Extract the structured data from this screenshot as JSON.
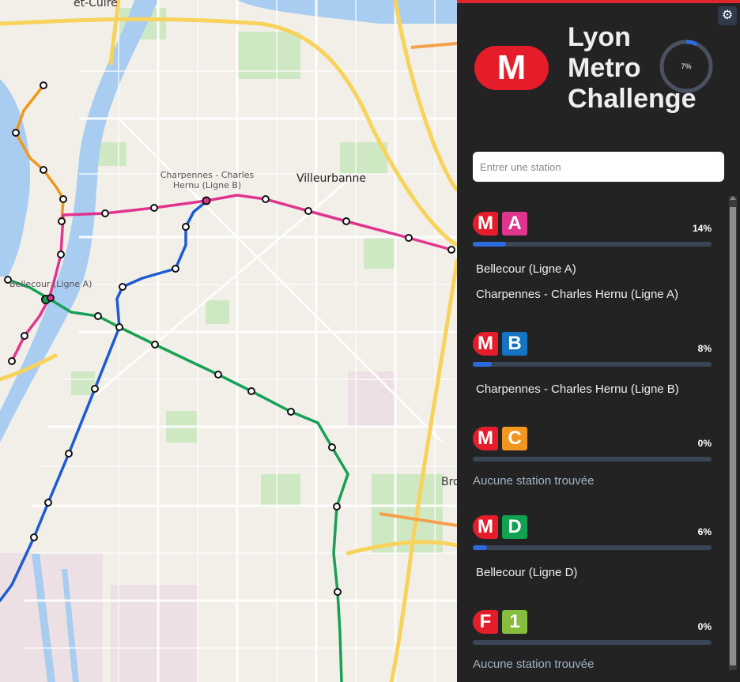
{
  "map": {
    "labels": {
      "caluire": "et-Cuire",
      "villeurbanne": "Villeurbanne",
      "charpennes_b": "Charpennes - Charles Hernu (Ligne B)",
      "bellecour_a": "Bellecour (Ligne A)",
      "bron": "Bro"
    },
    "line_colors": {
      "A": "#e0358f",
      "B": "#1d5bd1",
      "C": "#f0961d",
      "D": "#17a154",
      "F1": "#8bbf3a"
    }
  },
  "panel": {
    "settings_icon": "gear-icon",
    "logo_letter": "M",
    "title_lines": [
      "Lyon",
      "Metro",
      "Challenge"
    ],
    "overall_progress": 0.07,
    "overall_progress_label": "7%",
    "search": {
      "placeholder": "Entrer une station",
      "value": ""
    },
    "lines": [
      {
        "id": "A",
        "prefix": "M",
        "code": "A",
        "color": "#e0358f",
        "percent_label": "14%",
        "progress": 0.14,
        "stations": [
          "Bellecour (Ligne A)",
          "Charpennes - Charles Hernu (Ligne A)"
        ],
        "empty_text": ""
      },
      {
        "id": "B",
        "prefix": "M",
        "code": "B",
        "color": "#1573c4",
        "percent_label": "8%",
        "progress": 0.08,
        "stations": [
          "Charpennes - Charles Hernu (Ligne B)"
        ],
        "empty_text": ""
      },
      {
        "id": "C",
        "prefix": "M",
        "code": "C",
        "color": "#f39620",
        "percent_label": "0%",
        "progress": 0,
        "stations": [],
        "empty_text": "Aucune station trouvée"
      },
      {
        "id": "D",
        "prefix": "M",
        "code": "D",
        "color": "#12a150",
        "percent_label": "6%",
        "progress": 0.06,
        "stations": [
          "Bellecour (Ligne D)"
        ],
        "empty_text": ""
      },
      {
        "id": "F1",
        "prefix": "F",
        "code": "1",
        "color": "#87bd3d",
        "percent_label": "0%",
        "progress": 0,
        "stations": [],
        "empty_text": "Aucune station trouvée"
      }
    ]
  }
}
